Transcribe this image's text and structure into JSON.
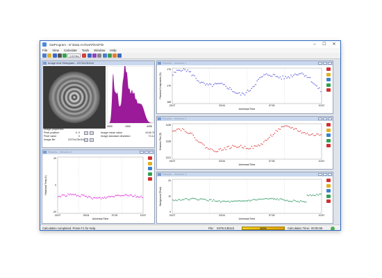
{
  "window": {
    "title": "SatProgram - D:\\Data Archive\\Files\\File",
    "controls": [
      "–",
      "☐",
      "✕"
    ]
  },
  "menu": [
    "File",
    "View",
    "Calculate",
    "Tools",
    "Window",
    "Help"
  ],
  "toolbar": {
    "combo_value": "0.0 Hrs",
    "icons": [
      "new-icon",
      "open-icon",
      "save-icon",
      "print-icon",
      "refresh-icon",
      "play-icon",
      "zoom-icon",
      "chart-icon",
      "settings-icon",
      "grid-icon",
      "cursor-icon",
      "export-icon",
      "help-icon"
    ],
    "icon_colors": [
      "#4a7bd0",
      "#e0b030",
      "#3a68c0",
      "#555555",
      "#3aa050",
      "#d04040",
      "#3a68c0",
      "#9040c0",
      "#888888",
      "#4a7bd0",
      "#3aa050",
      "#e08030",
      "#3a68c0"
    ]
  },
  "histogram_panel": {
    "title": "Image And Histogram",
    "file": "0370c13b11b",
    "hist_xlabels": [
      "0000",
      "1900",
      "4095"
    ],
    "properties": [
      {
        "label": "Image properties",
        "value": ""
      },
      {
        "label": "Pixel position",
        "value": "0, 0"
      },
      {
        "label": "Pixel value",
        "value": "0"
      },
      {
        "label": "Image file",
        "value": "0370c13b11b"
      }
    ],
    "stats": [
      {
        "label": "Image mean value",
        "value": "4146.76"
      },
      {
        "label": "Image standard deviation",
        "value": "74.12"
      }
    ]
  },
  "panels": [
    {
      "id": "results-polarized",
      "title": "Results - Window 1",
      "ylabel": "Polarized Components (%)",
      "xlabel": "Universal Time",
      "color": "#6a6ae0",
      "yticks": [
        "175",
        "170",
        "165"
      ],
      "xticks": [
        "23:07",
        "03:04",
        "07:00",
        "10:57"
      ]
    },
    {
      "id": "results-emission",
      "title": "Results - Window 2",
      "ylabel": "Emission Flux (R)",
      "xlabel": "Universal Time",
      "color": "#e05050",
      "yticks": [
        "1135",
        "1128",
        "1121"
      ],
      "xticks": [
        "23:07",
        "03:04",
        "07:00",
        "10:57"
      ]
    },
    {
      "id": "results-background",
      "title": "Results - Window 3",
      "ylabel": "Background (R/nm)",
      "xlabel": "Universal Time",
      "color": "#40a070",
      "yticks": [
        "20",
        "10",
        "0"
      ],
      "xticks": [
        "23:07",
        "03:04",
        "07:00",
        "10:57"
      ]
    },
    {
      "id": "results-rotational",
      "title": "Results - Window 4",
      "ylabel": "Rotational Temp (K)",
      "xlabel": "Universal Time",
      "color": "#e040e0",
      "yticks": [
        "20",
        "0",
        "-20"
      ],
      "xticks": [
        "23:07",
        "03:04",
        "07:00",
        "10:57"
      ]
    }
  ],
  "statusbar": {
    "message": "Calculation completed. Press F1 for Help.",
    "file_label": "File:",
    "file": "0370c13b11b",
    "progress_text": "100%",
    "progress": 1.0,
    "time_label": "Calculation Time:",
    "time": "00:00:06"
  }
}
